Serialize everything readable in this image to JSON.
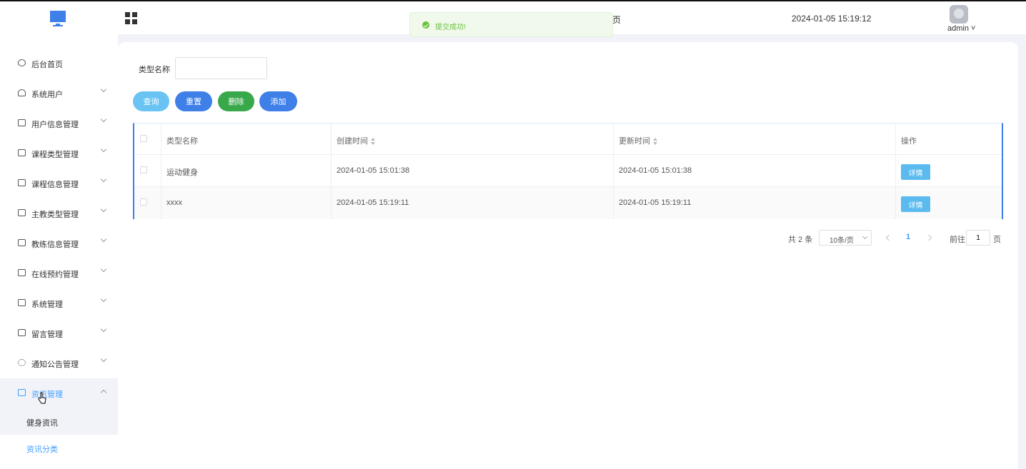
{
  "header": {
    "datetime": "2024-01-05 15:19:12",
    "username": "admin",
    "stray_text": "页"
  },
  "toast": {
    "message": "提交成功!"
  },
  "sidebar": {
    "items": [
      {
        "label": "后台首页",
        "icon": "dashboard-icon"
      },
      {
        "label": "系统用户",
        "icon": "user-icon"
      },
      {
        "label": "用户信息管理",
        "icon": "list-icon"
      },
      {
        "label": "课程类型管理",
        "icon": "list-icon"
      },
      {
        "label": "课程信息管理",
        "icon": "list-icon"
      },
      {
        "label": "主教类型管理",
        "icon": "list-icon"
      },
      {
        "label": "教练信息管理",
        "icon": "list-icon"
      },
      {
        "label": "在线预约管理",
        "icon": "calendar-icon"
      },
      {
        "label": "系统管理",
        "icon": "folder-icon"
      },
      {
        "label": "留言管理",
        "icon": "folder-icon"
      },
      {
        "label": "通知公告管理",
        "icon": "loading-icon"
      },
      {
        "label": "资讯管理",
        "icon": "news-icon"
      }
    ],
    "sub_items": [
      {
        "label": "健身资讯"
      },
      {
        "label": "资讯分类"
      }
    ]
  },
  "search": {
    "label": "类型名称",
    "value": ""
  },
  "buttons": {
    "query": "查询",
    "reset": "重置",
    "delete": "删除",
    "add": "添加"
  },
  "table": {
    "columns": [
      "类型名称",
      "创建时间",
      "更新时间",
      "操作"
    ],
    "rows": [
      {
        "name": "运动健身",
        "created": "2024-01-05 15:01:38",
        "updated": "2024-01-05 15:01:38",
        "action": "详情"
      },
      {
        "name": "xxxx",
        "created": "2024-01-05 15:19:11",
        "updated": "2024-01-05 15:19:11",
        "action": "详情"
      }
    ]
  },
  "pagination": {
    "total": "共 2 条",
    "page_size": "10条/页",
    "current_page": "1",
    "goto_label": "前往",
    "goto_value": "1",
    "page_suffix": "页"
  },
  "colors": {
    "primary": "#409eff",
    "button_blue": "#3e7fe8",
    "button_light_blue": "#69c4f3",
    "button_green": "#39a84a",
    "success_text": "#67c23a"
  }
}
